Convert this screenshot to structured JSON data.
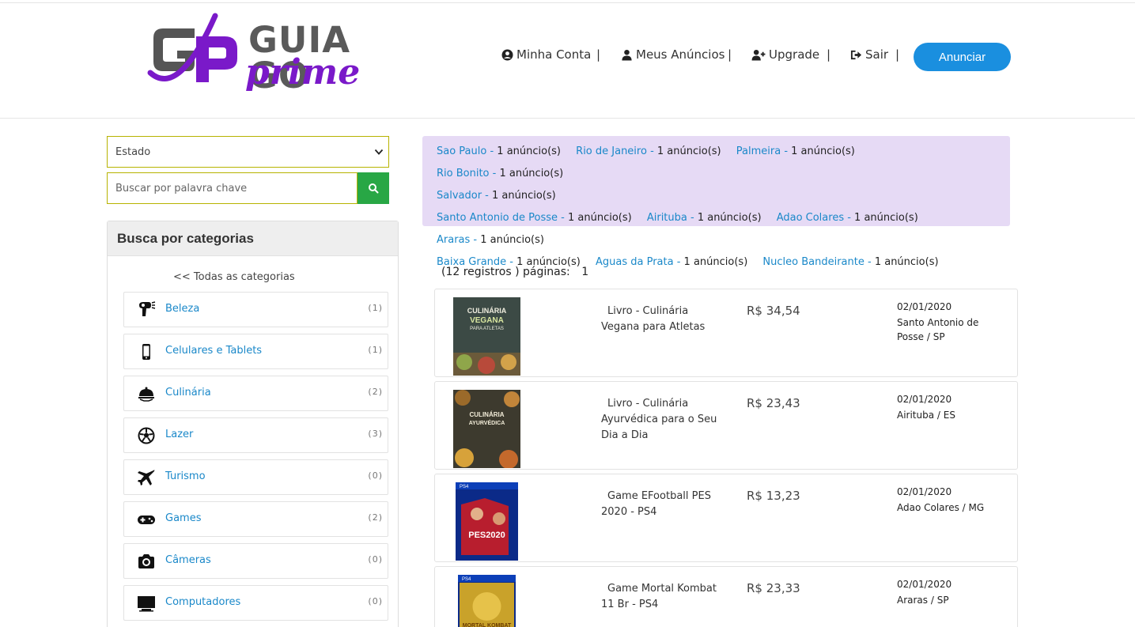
{
  "brand": {
    "text": "GUIA GO",
    "sub": "prime",
    "primary_color": "#7a19c9",
    "gray": "#5a5a5a"
  },
  "nav": {
    "account": "Minha Conta",
    "my_ads": "Meus Anúncios",
    "upgrade": "Upgrade",
    "logout": "Sair",
    "separator": "|",
    "cta": "Anunciar",
    "cta_color": "#1a8fdf"
  },
  "filters": {
    "state_selected": "Estado",
    "search_placeholder": "Buscar por palavra chave"
  },
  "categories": {
    "heading": "Busca por categorias",
    "all_link": "<< Todas as categorias",
    "items": [
      {
        "label": "Beleza",
        "count": "(1)",
        "icon": "hair-dryer-icon"
      },
      {
        "label": "Celulares e Tablets",
        "count": "(1)",
        "icon": "mobile-phone-icon"
      },
      {
        "label": "Culinária",
        "count": "(2)",
        "icon": "food-cloche-icon"
      },
      {
        "label": "Lazer",
        "count": "(3)",
        "icon": "soccer-ball-icon"
      },
      {
        "label": "Turismo",
        "count": "(0)",
        "icon": "airplane-icon"
      },
      {
        "label": "Games",
        "count": "(2)",
        "icon": "gamepad-icon"
      },
      {
        "label": "Câmeras",
        "count": "(0)",
        "icon": "camera-icon"
      },
      {
        "label": "Computadores",
        "count": "(0)",
        "icon": "desktop-monitor-icon"
      }
    ]
  },
  "cities": [
    {
      "name": "Sao Paulo -",
      "count": " 1 anúncio(s)"
    },
    {
      "name": "Rio de Janeiro -",
      "count": " 1 anúncio(s)"
    },
    {
      "name": "Palmeira -",
      "count": " 1 anúncio(s)"
    },
    {
      "name": "Rio Bonito -",
      "count": " 1 anúncio(s)"
    },
    {
      "name": "Salvador -",
      "count": " 1 anúncio(s)"
    },
    {
      "name": "Santo Antonio de Posse -",
      "count": " 1 anúncio(s)"
    },
    {
      "name": "Airituba -",
      "count": " 1 anúncio(s)"
    },
    {
      "name": "Adao Colares -",
      "count": " 1 anúncio(s)"
    },
    {
      "name": "Araras -",
      "count": " 1 anúncio(s)"
    },
    {
      "name": "Baixa Grande -",
      "count": " 1 anúncio(s)"
    },
    {
      "name": "Aguas da Prata -",
      "count": " 1 anúncio(s)"
    },
    {
      "name": "Nucleo Bandeirante -",
      "count": " 1 anúncio(s)"
    }
  ],
  "results": {
    "records": "(12 registros )",
    "pages_label": "páginas:",
    "page": "1"
  },
  "ads": [
    {
      "title": "Livro - Culinária Vegana para Atletas",
      "price": "R$ 34,54",
      "date": "02/01/2020",
      "location": "Santo Antonio de Posse / SP",
      "cover_title": "CULINÁRIA VEGANA",
      "cover_sub": "PARA ATLETAS"
    },
    {
      "title": "Livro - Culinária Ayurvédica para o Seu Dia a Dia",
      "price": "R$ 23,43",
      "date": "02/01/2020",
      "location": "Airituba / ES",
      "cover_title": "CULINÁRIA AYURVÉDICA",
      "cover_sub": ""
    },
    {
      "title": "Game EFootball PES 2020 - PS4",
      "price": "R$ 13,23",
      "date": "02/01/2020",
      "location": "Adao Colares / MG",
      "cover_title": "PES2020",
      "cover_sub": "PS4"
    },
    {
      "title": "Game Mortal Kombat 11 Br - PS4",
      "price": "R$ 23,33",
      "date": "02/01/2020",
      "location": "Araras / SP",
      "cover_title": "MORTAL KOMBAT",
      "cover_sub": "PS4"
    }
  ]
}
